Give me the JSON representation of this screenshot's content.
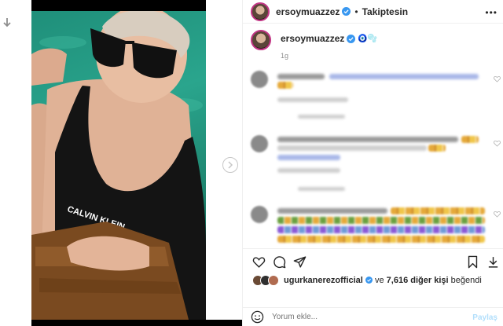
{
  "header": {
    "username": "ersoymuazzez",
    "separator": "•",
    "follow_label": "Takiptesin",
    "more_label": "•••"
  },
  "caption": {
    "username": "ersoymuazzez",
    "emoji": "🧿🫧",
    "time": "1g"
  },
  "likes": {
    "username": "ugurkanerezofficial",
    "conjunction": "ve",
    "count_text": "7,616 diğer kişi",
    "suffix": "beğendi"
  },
  "comment_box": {
    "placeholder": "Yorum ekle...",
    "post_label": "Paylaş"
  },
  "colors": {
    "accent": "#0095f6",
    "verified": "#3897f0",
    "post_disabled": "#b2dffc",
    "media_water": "#2aa58d"
  },
  "icons": {
    "like": "heart-icon",
    "comment": "comment-icon",
    "share": "paper-plane-icon",
    "save": "bookmark-icon",
    "download": "download-icon"
  }
}
